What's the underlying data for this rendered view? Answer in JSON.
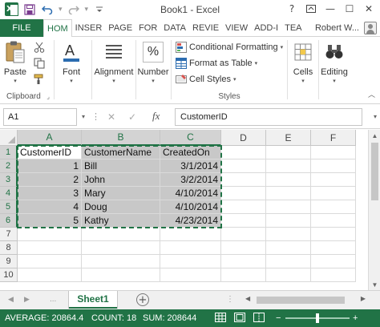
{
  "window": {
    "title": "Book1 - Excel",
    "help": "?",
    "restore": "⊡",
    "minimize": "—",
    "maximize": "☐",
    "close": "✕"
  },
  "qat": {
    "save_icon": "save-icon",
    "undo_icon": "undo-icon",
    "redo_icon": "redo-icon",
    "customize_icon": "customize-icon"
  },
  "ribbon_tabs": {
    "file": "FILE",
    "tabs": [
      "HOM",
      "INSER",
      "PAGE",
      "FOR",
      "DATA",
      "REVIE",
      "VIEW",
      "ADD-I",
      "TEA"
    ],
    "active_index": 0,
    "user": "Robert W..."
  },
  "ribbon": {
    "clipboard": {
      "paste": "Paste",
      "label": "Clipboard",
      "launcher": "⌟"
    },
    "font": {
      "label": "Font"
    },
    "alignment": {
      "label": "Alignment"
    },
    "number": {
      "label": "Number",
      "symbol": "%"
    },
    "styles": {
      "conditional_formatting": "Conditional Formatting",
      "format_as_table": "Format as Table",
      "cell_styles": "Cell Styles",
      "label": "Styles"
    },
    "cells": {
      "label": "Cells"
    },
    "editing": {
      "label": "Editing"
    }
  },
  "formula_bar": {
    "name_box": "A1",
    "fx": "fx",
    "cancel": "✕",
    "enter": "✓",
    "content": "CustomerID"
  },
  "grid": {
    "columns": [
      "A",
      "B",
      "C",
      "D",
      "E",
      "F"
    ],
    "rows": [
      "1",
      "2",
      "3",
      "4",
      "5",
      "6",
      "7",
      "8",
      "9",
      "10"
    ],
    "selected_columns": [
      "A",
      "B",
      "C"
    ],
    "selected_rows": [
      "1",
      "2",
      "3",
      "4",
      "5",
      "6"
    ],
    "cells": {
      "A1": "CustomerID",
      "B1": "CustomerName",
      "C1": "CreatedOn",
      "A2": "1",
      "B2": "Bill",
      "C2": "3/1/2014",
      "A3": "2",
      "B3": "John",
      "C3": "3/2/2014",
      "A4": "3",
      "B4": "Mary",
      "C4": "4/10/2014",
      "A5": "4",
      "B5": "Doug",
      "C5": "4/10/2014",
      "A6": "5",
      "B6": "Kathy",
      "C6": "4/23/2014"
    }
  },
  "sheets": {
    "active": "Sheet1",
    "add": "+",
    "more": "..."
  },
  "status": {
    "average": "AVERAGE: 20864.4",
    "count": "COUNT: 18",
    "sum": "SUM: 208644"
  },
  "colors": {
    "accent": "#217346",
    "selection": "#c8c8c8"
  }
}
